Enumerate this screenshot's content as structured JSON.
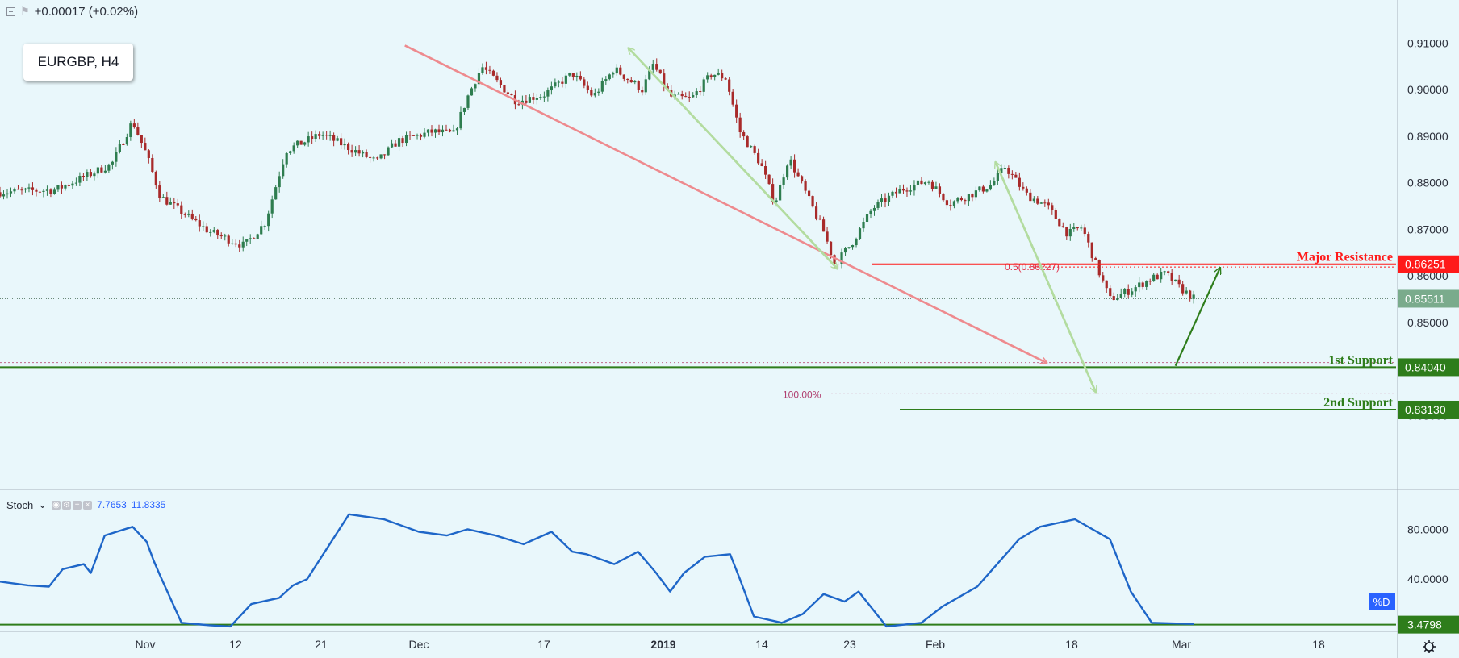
{
  "header": {
    "change": "+0.00017 (+0.02%)",
    "symbol_box": "EURGBP, H4"
  },
  "stoch": {
    "name": "Stoch",
    "k": "7.7653",
    "d": "11.8335",
    "d_tag": "%D"
  },
  "colors": {
    "background": "#e9f7fb",
    "candle_up": "#2e7d4f",
    "candle_down": "#a82a2a",
    "resistance": "#ff1a1a",
    "support": "#2e7d1b",
    "stoch_line": "#1e66c8",
    "price_tag": "#7aab8c",
    "arrow_pink": "#ee8a8e",
    "arrow_green_light": "#b3dca0",
    "arrow_green_dark": "#2e7d1b"
  },
  "icons": [
    "collapse-icon",
    "flag-icon",
    "settings-gear-icon"
  ],
  "chart_data": [
    {
      "type": "candlestick",
      "title": "EURGBP, H4",
      "y_axis_ticks": [
        "0.91000",
        "0.90000",
        "0.89000",
        "0.88000",
        "0.87000",
        "0.86000",
        "0.85000",
        "0.84000",
        "0.83000"
      ],
      "ylim": [
        0.8145,
        0.9158
      ],
      "x_axis_ticks": [
        "Nov",
        "12",
        "21",
        "Dec",
        "17",
        "2019",
        "14",
        "23",
        "Feb",
        "18",
        "Mar",
        "18"
      ],
      "close_path": [
        {
          "x": 0,
          "y": 0.878
        },
        {
          "x": 0.04,
          "y": 0.8785
        },
        {
          "x": 0.08,
          "y": 0.884
        },
        {
          "x": 0.095,
          "y": 0.8932
        },
        {
          "x": 0.105,
          "y": 0.886
        },
        {
          "x": 0.115,
          "y": 0.877
        },
        {
          "x": 0.15,
          "y": 0.8695
        },
        {
          "x": 0.175,
          "y": 0.8665
        },
        {
          "x": 0.19,
          "y": 0.8715
        },
        {
          "x": 0.205,
          "y": 0.887
        },
        {
          "x": 0.23,
          "y": 0.8905
        },
        {
          "x": 0.27,
          "y": 0.8845
        },
        {
          "x": 0.285,
          "y": 0.889
        },
        {
          "x": 0.31,
          "y": 0.891
        },
        {
          "x": 0.325,
          "y": 0.8905
        },
        {
          "x": 0.335,
          "y": 0.8985
        },
        {
          "x": 0.345,
          "y": 0.905
        },
        {
          "x": 0.37,
          "y": 0.8975
        },
        {
          "x": 0.39,
          "y": 0.899
        },
        {
          "x": 0.41,
          "y": 0.9035
        },
        {
          "x": 0.425,
          "y": 0.8985
        },
        {
          "x": 0.44,
          "y": 0.9045
        },
        {
          "x": 0.46,
          "y": 0.9,
          "nb": 1
        },
        {
          "x": 0.468,
          "y": 0.9055
        },
        {
          "x": 0.48,
          "y": 0.8985
        },
        {
          "x": 0.495,
          "y": 0.898
        },
        {
          "x": 0.51,
          "y": 0.9035
        },
        {
          "x": 0.52,
          "y": 0.9025
        },
        {
          "x": 0.53,
          "y": 0.891
        },
        {
          "x": 0.545,
          "y": 0.884
        },
        {
          "x": 0.555,
          "y": 0.8755
        },
        {
          "x": 0.565,
          "y": 0.8855
        },
        {
          "x": 0.58,
          "y": 0.876
        },
        {
          "x": 0.59,
          "y": 0.8695
        },
        {
          "x": 0.598,
          "y": 0.8625
        },
        {
          "x": 0.61,
          "y": 0.867
        },
        {
          "x": 0.625,
          "y": 0.8745
        },
        {
          "x": 0.645,
          "y": 0.8785
        },
        {
          "x": 0.665,
          "y": 0.8805
        },
        {
          "x": 0.68,
          "y": 0.8755
        },
        {
          "x": 0.71,
          "y": 0.8795
        },
        {
          "x": 0.72,
          "y": 0.8835
        },
        {
          "x": 0.735,
          "y": 0.8775
        },
        {
          "x": 0.75,
          "y": 0.875
        },
        {
          "x": 0.765,
          "y": 0.869
        },
        {
          "x": 0.775,
          "y": 0.8705
        },
        {
          "x": 0.785,
          "y": 0.8625
        },
        {
          "x": 0.795,
          "y": 0.855
        },
        {
          "x": 0.81,
          "y": 0.857
        },
        {
          "x": 0.825,
          "y": 0.8595
        },
        {
          "x": 0.835,
          "y": 0.8605
        },
        {
          "x": 0.845,
          "y": 0.8575
        },
        {
          "x": 0.855,
          "y": 0.8552
        }
      ],
      "price_lines": [
        {
          "name": "Major Resistance",
          "value": "0.86251",
          "color": "resistance",
          "style": "solid"
        },
        {
          "name": "1st Support",
          "value": "0.84040",
          "color": "support",
          "style": "solid"
        },
        {
          "name": "2nd Support",
          "value": "0.83130",
          "color": "support",
          "style": "solid"
        }
      ],
      "current_price": "0.85511",
      "fib_labels": [
        {
          "text": "0.5(0.86227)",
          "value": 0.86227
        },
        {
          "text": "100.00%",
          "value": 0.8347
        }
      ],
      "arrows": [
        {
          "from": [
            0.29,
            0.9095
          ],
          "to": [
            0.75,
            0.8413
          ],
          "color": "arrow_pink"
        },
        {
          "from": [
            0.45,
            0.909
          ],
          "to": [
            0.6,
            0.8615
          ],
          "color": "arrow_green_light"
        },
        {
          "from": [
            0.6,
            0.8615
          ],
          "to": [
            0.45,
            0.909
          ],
          "color": "arrow_green_light"
        },
        {
          "from": [
            0.713,
            0.8845
          ],
          "to": [
            0.785,
            0.835
          ],
          "color": "arrow_green_light"
        },
        {
          "from": [
            0.785,
            0.835
          ],
          "to": [
            0.713,
            0.8845
          ],
          "color": "arrow_green_light"
        },
        {
          "from": [
            0.842,
            0.8407
          ],
          "to": [
            0.874,
            0.8618
          ],
          "color": "arrow_green_dark"
        }
      ]
    },
    {
      "type": "line",
      "title": "Stoch",
      "series_name": "%D",
      "y_axis_ticks": [
        "80.0000",
        "40.0000"
      ],
      "ylim": [
        0,
        110
      ],
      "current_value_tag": "3.4798",
      "horizontal_line_value": 3.4798,
      "x": [
        0,
        0.02,
        0.035,
        0.045,
        0.06,
        0.065,
        0.075,
        0.095,
        0.105,
        0.11,
        0.115,
        0.13,
        0.15,
        0.165,
        0.18,
        0.2,
        0.21,
        0.22,
        0.25,
        0.275,
        0.3,
        0.32,
        0.335,
        0.355,
        0.375,
        0.395,
        0.41,
        0.42,
        0.44,
        0.457,
        0.47,
        0.48,
        0.49,
        0.505,
        0.523,
        0.53,
        0.54,
        0.56,
        0.575,
        0.59,
        0.605,
        0.615,
        0.635,
        0.66,
        0.675,
        0.7,
        0.73,
        0.745,
        0.77,
        0.795,
        0.81,
        0.825,
        0.855
      ],
      "values": [
        38,
        35,
        34,
        48,
        52,
        45,
        75,
        82,
        70,
        55,
        42,
        5,
        3,
        2,
        20,
        25,
        35,
        40,
        92,
        88,
        78,
        75,
        80,
        75,
        68,
        78,
        62,
        60,
        52,
        62,
        45,
        30,
        45,
        58,
        60,
        40,
        10,
        5,
        12,
        28,
        22,
        30,
        2,
        5,
        18,
        34,
        72,
        82,
        88,
        72,
        30,
        5,
        4
      ]
    }
  ]
}
